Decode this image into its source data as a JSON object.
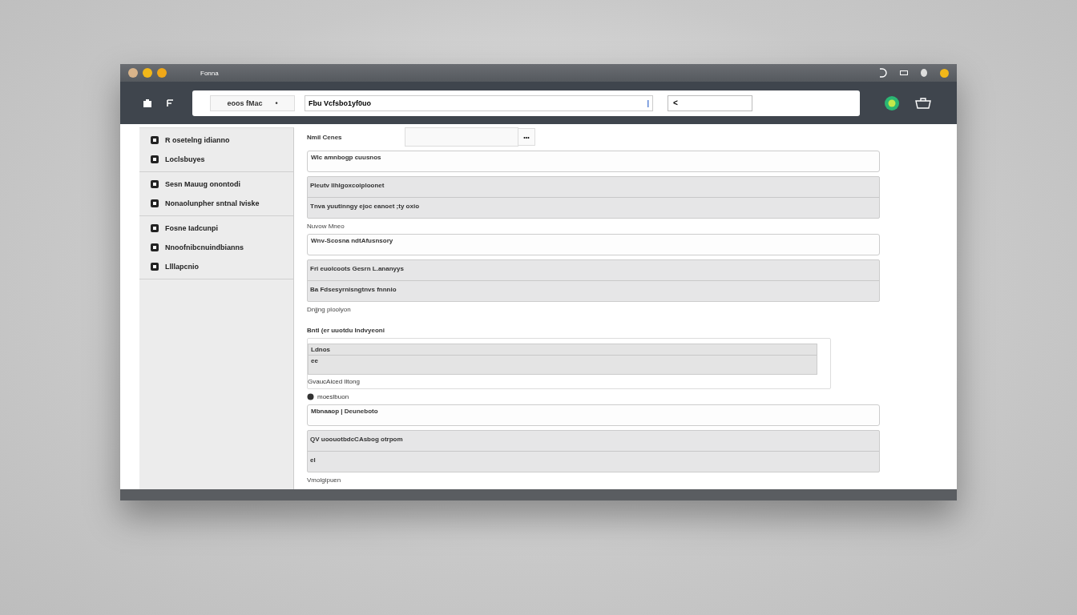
{
  "window": {
    "title": "Fonna"
  },
  "toolbar": {
    "tab": {
      "label": "eoos fMac",
      "marker": "•"
    },
    "address": {
      "value": "Fbu Vcfsbo1yf0uo",
      "cursor": "|"
    },
    "small_field": {
      "value": "<"
    }
  },
  "sidebar": {
    "groups": [
      {
        "items": [
          "R osetelng idianno",
          "Loclsbuyes"
        ]
      },
      {
        "items": [
          "Sesn Mauug onontodi",
          "Nonaolunpher sntnal Iviske"
        ]
      },
      {
        "items": [
          "Fosne Iadcunpi",
          "Nnoofnibcnuindbianns",
          "Llllapcnio"
        ]
      }
    ]
  },
  "main": {
    "rows": [
      {
        "kind": "select",
        "label": "Nmil Cenes",
        "button": "•••"
      },
      {
        "kind": "field",
        "value": "Wlc amnbogp cuusnos"
      },
      {
        "kind": "group",
        "lines": [
          "Pleutv Ilhlgoxcoiploonet",
          "Tnva yuutinngy ejoc eanoet ;ty oxio"
        ]
      },
      {
        "kind": "note",
        "text": "Nuvow Mneo"
      },
      {
        "kind": "field",
        "value": "Wnv-Scosna ndtAfusnsory"
      },
      {
        "kind": "group",
        "lines": [
          "Fri euolcoots Gesrn L.ananyys",
          "Ba Fdsesyrnisngtnvs fnnnio"
        ]
      },
      {
        "kind": "note",
        "text": "Dnjjng ploolyon"
      },
      {
        "kind": "heading",
        "text": "Bntl (er uuotdu Indvyeoni"
      },
      {
        "kind": "panel",
        "lines": [
          "Ldnos",
          "ee"
        ],
        "caption": "GvaucAiced Iltong"
      },
      {
        "kind": "option",
        "text": "moeslbuon"
      },
      {
        "kind": "field",
        "value": "Mbnaaop | Deuneboto"
      },
      {
        "kind": "group",
        "lines": [
          "QV uoouotbdcCAsbog otrpom",
          "el"
        ]
      },
      {
        "kind": "note",
        "text": "Vmolgipuen"
      }
    ]
  }
}
